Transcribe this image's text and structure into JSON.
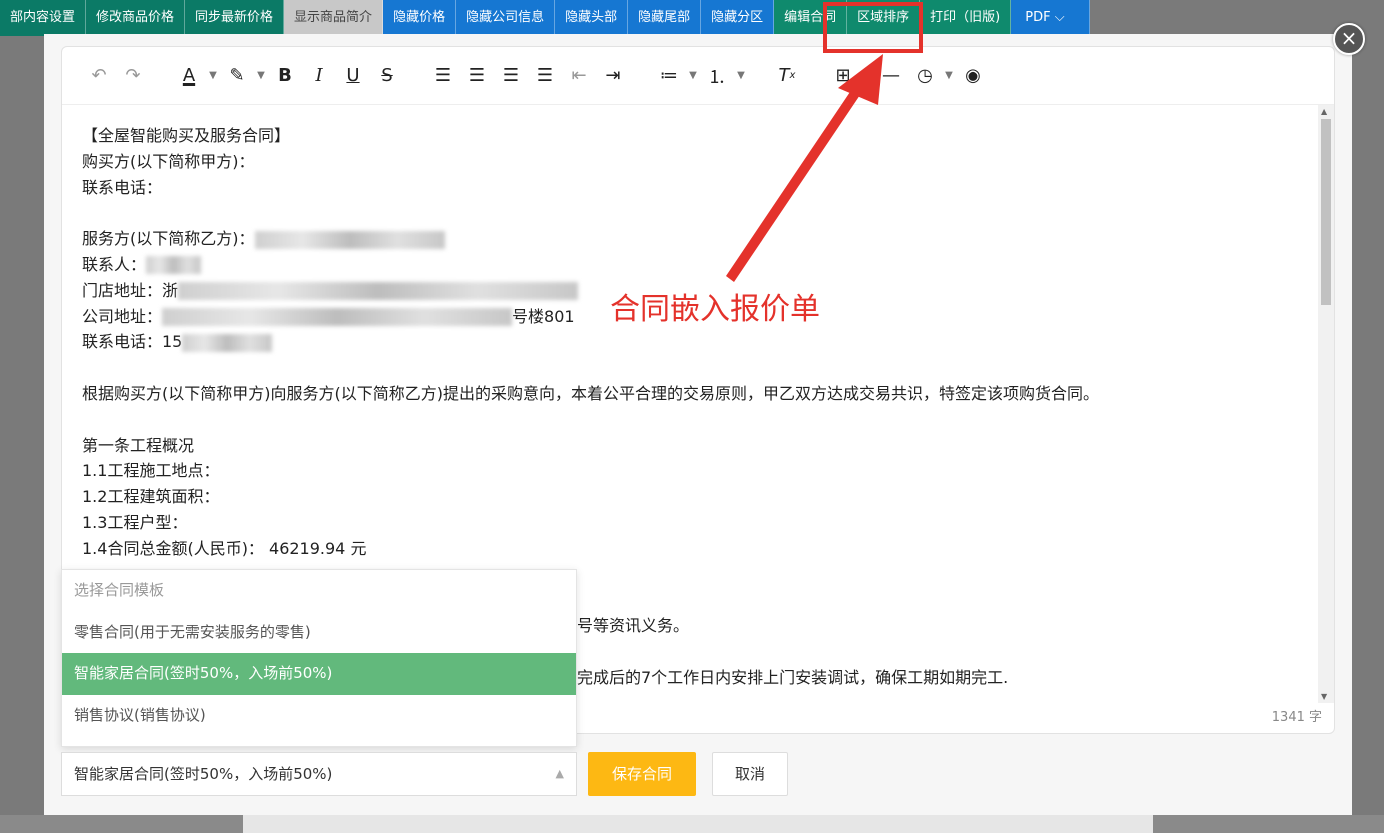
{
  "top_tabs": [
    {
      "label": "部内容设置",
      "style": "teal"
    },
    {
      "label": "修改商品价格",
      "style": "teal"
    },
    {
      "label": "同步最新价格",
      "style": "teal"
    },
    {
      "label": "显示商品简介",
      "style": "gray"
    },
    {
      "label": "隐藏价格",
      "style": "blue"
    },
    {
      "label": "隐藏公司信息",
      "style": "blue"
    },
    {
      "label": "隐藏头部",
      "style": "blue"
    },
    {
      "label": "隐藏尾部",
      "style": "blue"
    },
    {
      "label": "隐藏分区",
      "style": "blue"
    },
    {
      "label": "编辑合同",
      "style": "green"
    },
    {
      "label": "区域排序",
      "style": "green"
    },
    {
      "label": "打印（旧版)",
      "style": "green"
    },
    {
      "label": "PDF ⌵",
      "style": "blue"
    }
  ],
  "modal": {
    "close_icon": "×",
    "toolbar_icons": [
      "undo-icon",
      "redo-icon",
      "font-color-icon",
      "highlight-icon",
      "bold-icon",
      "italic-icon",
      "underline-icon",
      "strikethrough-icon",
      "align-left-icon",
      "align-center-icon",
      "align-right-icon",
      "align-justify-icon",
      "outdent-icon",
      "indent-icon",
      "bullet-list-icon",
      "numbered-list-icon",
      "clear-format-icon",
      "table-icon",
      "horizontal-rule-icon",
      "time-icon",
      "preview-icon"
    ],
    "content": {
      "title": "【全屋智能购买及服务合同】",
      "buyer": "购买方(以下简称甲方)：",
      "buyer_phone": "联系电话：",
      "provider": "服务方(以下简称乙方)：",
      "contact": "联系人：",
      "store_address": "门店地址：浙",
      "company_address": "公司地址：",
      "company_address_tail": "号楼801",
      "provider_phone": "联系电话：15",
      "intro": "根据购买方(以下简称甲方)向服务方(以下简称乙方)提出的采购意向，本着公平合理的交易原则，甲乙双方达成交易共识，特签定该项购货合同。",
      "section1": "第一条工程概况",
      "item1_1": "1.1工程施工地点：",
      "item1_2": "1.2工程建筑面积：",
      "item1_3": "1.3工程户型：",
      "item1_4": "1.4合同总金额(人民币)：  46219.94 元",
      "line_partial_1": "号等资讯义务。",
      "line_partial_2": "完成后的7个工作日内安排上门安装调试，确保工期如期完工."
    },
    "word_count": "1341 字",
    "dropdown": {
      "header": "选择合同模板",
      "options": [
        "零售合同(用于无需安装服务的零售)",
        "智能家居合同(签时50%，入场前50%)",
        "销售协议(销售协议)"
      ],
      "active_index": 1
    },
    "selected_template": "智能家居合同(签时50%，入场前50%)",
    "save_label": "保存合同",
    "cancel_label": "取消"
  },
  "annotation": {
    "text": "合同嵌入报价单",
    "color": "#e4322b"
  }
}
